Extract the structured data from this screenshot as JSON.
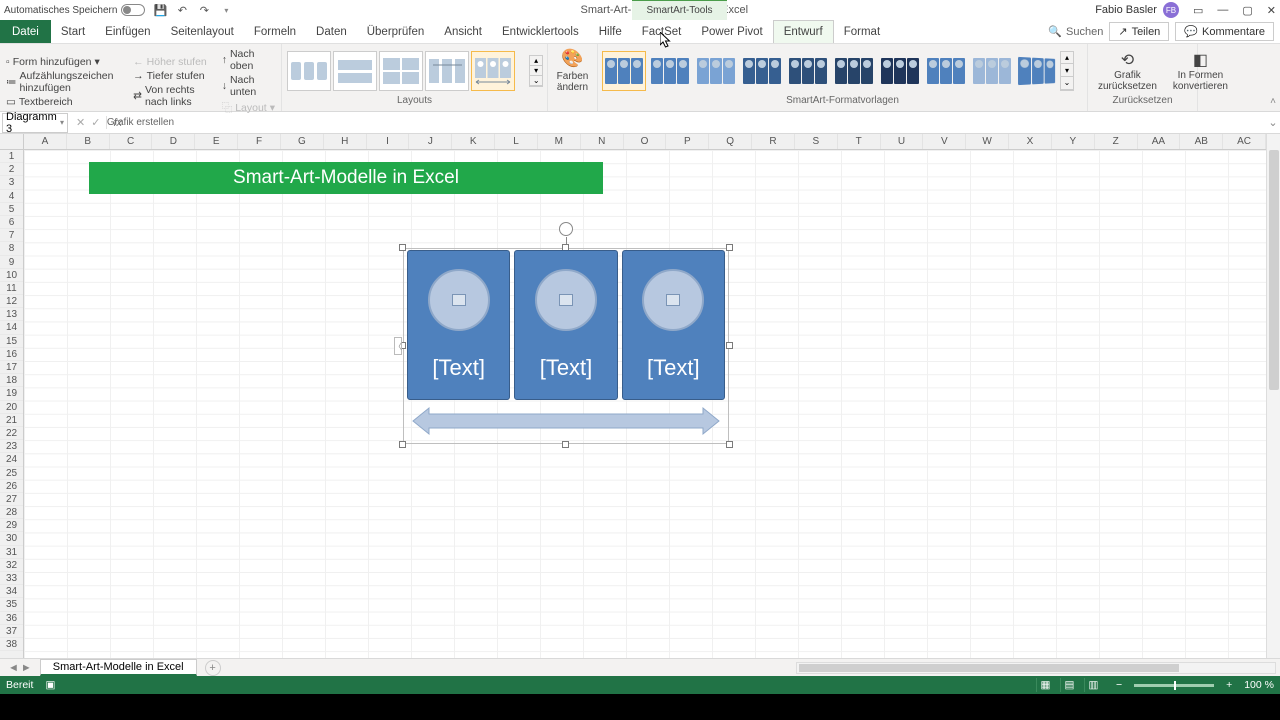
{
  "title": {
    "autosave": "Automatisches Speichern",
    "doc": "Smart-Art-Modelle in Excel  -  Excel",
    "context_tab": "SmartArt-Tools",
    "user": "Fabio Basler",
    "user_initials": "FB"
  },
  "tabs": {
    "file": "Datei",
    "items": [
      "Start",
      "Einfügen",
      "Seitenlayout",
      "Formeln",
      "Daten",
      "Überprüfen",
      "Ansicht",
      "Entwicklertools",
      "Hilfe",
      "FactSet",
      "Power Pivot"
    ],
    "smartart": [
      "Entwurf",
      "Format"
    ],
    "search": "Suchen",
    "share": "Teilen",
    "comments": "Kommentare"
  },
  "ribbon": {
    "create": {
      "add_shape": "Form hinzufügen",
      "add_bullet": "Aufzählungszeichen hinzufügen",
      "text_area": "Textbereich",
      "promote": "Höher stufen",
      "demote": "Tiefer stufen",
      "rtl": "Von rechts nach links",
      "move_up": "Nach oben",
      "move_down": "Nach unten",
      "layout_btn": "Layout",
      "group_label": "Grafik erstellen"
    },
    "layouts_label": "Layouts",
    "colors": "Farben ändern",
    "styles_label": "SmartArt-Formatvorlagen",
    "reset": {
      "graphic": "Grafik zurücksetzen",
      "convert": "In Formen konvertieren",
      "group_label": "Zurücksetzen"
    }
  },
  "namebox": "Diagramm 3",
  "sheet": {
    "columns": [
      "A",
      "B",
      "C",
      "D",
      "E",
      "F",
      "G",
      "H",
      "I",
      "J",
      "K",
      "L",
      "M",
      "N",
      "O",
      "P",
      "Q",
      "R",
      "S",
      "T",
      "U",
      "V",
      "W",
      "X",
      "Y",
      "Z",
      "AA",
      "AB",
      "AC"
    ],
    "row_count": 38,
    "banner": "Smart-Art-Modelle in Excel",
    "smartart_text": "[Text]",
    "tab": "Smart-Art-Modelle in Excel"
  },
  "status": {
    "ready": "Bereit",
    "zoom": "100 %"
  }
}
